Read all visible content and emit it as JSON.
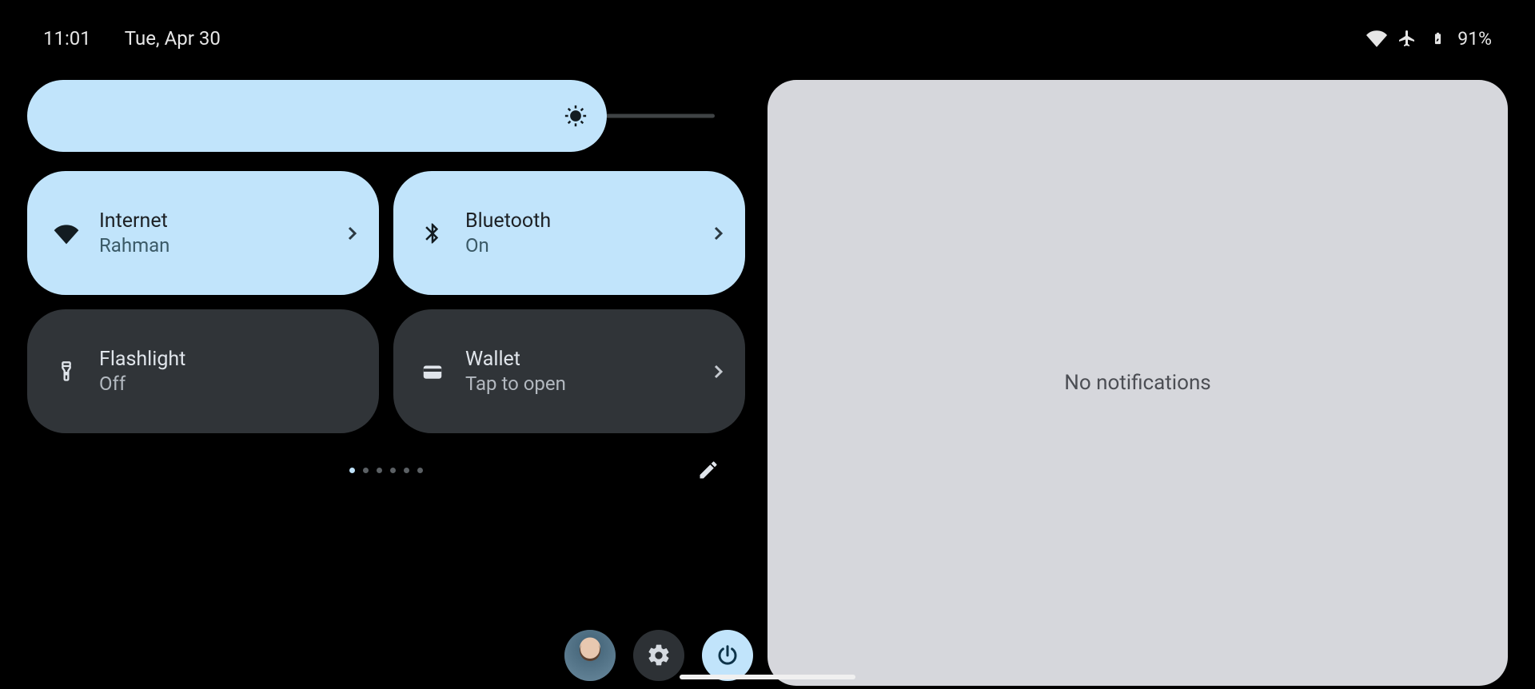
{
  "status": {
    "time": "11:01",
    "date": "Tue, Apr 30",
    "battery_text": "91%"
  },
  "brightness": {
    "level_percent": 83
  },
  "tiles": [
    {
      "title": "Internet",
      "sub": "Rahman",
      "icon": "wifi",
      "active": true,
      "expand": true
    },
    {
      "title": "Bluetooth",
      "sub": "On",
      "icon": "bluetooth",
      "active": true,
      "expand": true
    },
    {
      "title": "Flashlight",
      "sub": "Off",
      "icon": "flashlight",
      "active": false,
      "expand": false
    },
    {
      "title": "Wallet",
      "sub": "Tap to open",
      "icon": "wallet",
      "active": false,
      "expand": true
    }
  ],
  "pager": {
    "page_count": 6,
    "current": 0
  },
  "notifications": {
    "empty_label": "No notifications"
  }
}
